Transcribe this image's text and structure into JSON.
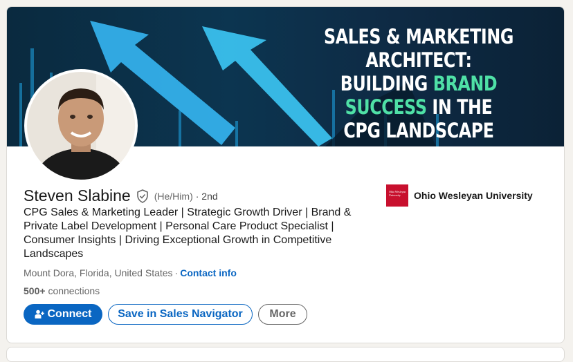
{
  "banner": {
    "line1": "SALES & MARKETING ARCHITECT:",
    "line2_pre": "BUILDING ",
    "line2_hl": "BRAND SUCCESS",
    "line2_post": " IN THE",
    "line3": "CPG LANDSCAPE",
    "accent_color": "#4fe0a6"
  },
  "profile": {
    "name": "Steven Slabine",
    "pronouns": "(He/Him)",
    "degree": "· 2nd",
    "headline": "CPG Sales & Marketing Leader | Strategic Growth Driver | Brand & Private Label Development | Personal Care Product Specialist | Consumer Insights | Driving Exceptional Growth in Competitive Landscapes",
    "location": "Mount Dora, Florida, United States",
    "separator": "·",
    "contact_label": "Contact info",
    "connections_count": "500+",
    "connections_label": "connections"
  },
  "education": {
    "logo_text": "Ohio Wesleyan University",
    "name": "Ohio Wesleyan University",
    "logo_color": "#c8102e"
  },
  "actions": {
    "connect_label": "Connect",
    "save_label": "Save in Sales Navigator",
    "more_label": "More"
  },
  "colors": {
    "primary": "#0a66c2",
    "text": "#191919",
    "muted": "#666666"
  }
}
